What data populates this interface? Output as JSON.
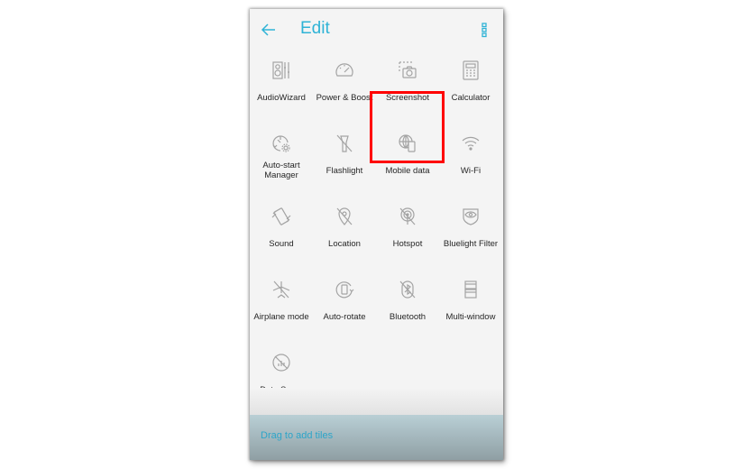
{
  "header": {
    "title": "Edit",
    "back_icon": "arrow-left-icon",
    "more_icon": "more-vertical-icon",
    "accent_color": "#2fb3d6"
  },
  "tiles": [
    {
      "label": "AudioWizard",
      "icon": "speaker-equalizer-icon"
    },
    {
      "label": "Power & Boost",
      "icon": "speedometer-icon"
    },
    {
      "label": "Screenshot",
      "icon": "screenshot-camera-icon",
      "highlighted": true
    },
    {
      "label": "Calculator",
      "icon": "calculator-icon"
    },
    {
      "label": "Auto-start Manager",
      "icon": "auto-start-gear-icon"
    },
    {
      "label": "Flashlight",
      "icon": "flashlight-off-icon"
    },
    {
      "label": "Mobile data",
      "icon": "globe-phone-icon"
    },
    {
      "label": "Wi-Fi",
      "icon": "wifi-icon"
    },
    {
      "label": "Sound",
      "icon": "vibrate-phone-icon"
    },
    {
      "label": "Location",
      "icon": "location-off-icon"
    },
    {
      "label": "Hotspot",
      "icon": "hotspot-off-icon"
    },
    {
      "label": "Bluelight Filter",
      "icon": "eye-shield-icon"
    },
    {
      "label": "Airplane mode",
      "icon": "airplane-off-icon"
    },
    {
      "label": "Auto-rotate",
      "icon": "rotate-phone-icon"
    },
    {
      "label": "Bluetooth",
      "icon": "bluetooth-off-icon"
    },
    {
      "label": "Multi-window",
      "icon": "multi-window-icon"
    },
    {
      "label": "Data Saver",
      "icon": "data-saver-off-icon"
    }
  ],
  "footer": {
    "hint": "Drag to add tiles"
  },
  "highlight_color": "#ff0000"
}
